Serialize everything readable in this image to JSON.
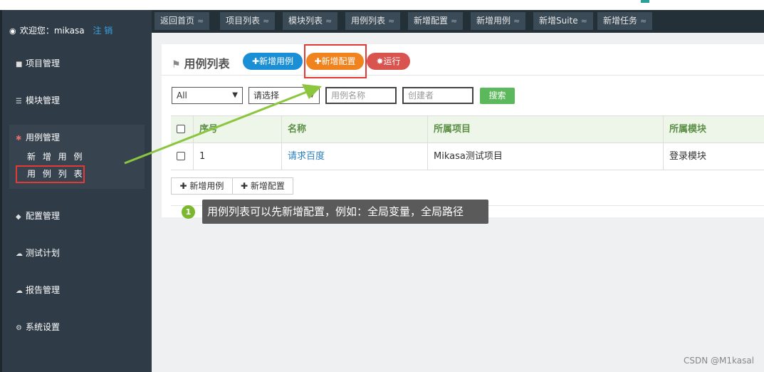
{
  "sidebar": {
    "welcome_text": "欢迎您：mikasa",
    "logout_label": "注 销",
    "items": [
      {
        "icon": "folder-icon",
        "label": "项目管理"
      },
      {
        "icon": "list-icon",
        "label": "模块管理"
      },
      {
        "icon": "bug-icon",
        "label": "用例管理"
      },
      {
        "icon": "tag-icon",
        "label": "配置管理"
      },
      {
        "icon": "cloud-icon",
        "label": "测试计划"
      },
      {
        "icon": "cloud-upload-icon",
        "label": "报告管理"
      },
      {
        "icon": "cogs-icon",
        "label": "系统设置"
      }
    ],
    "sub_items": [
      {
        "label": "新 增 用 例"
      },
      {
        "label": "用 例 列 表"
      }
    ]
  },
  "tabs": [
    {
      "label": "返回首页"
    },
    {
      "label": "项目列表"
    },
    {
      "label": "模块列表"
    },
    {
      "label": "用例列表"
    },
    {
      "label": "新增配置"
    },
    {
      "label": "新增用例"
    },
    {
      "label": "新增Suite"
    },
    {
      "label": "新增任务"
    }
  ],
  "panel": {
    "title": "用例列表",
    "add_case_label": "✚新增用例",
    "add_config_label": "✚新增配置",
    "run_label": "运行",
    "colors": {
      "add_case": "#1a8fd6",
      "add_config": "#f0831d",
      "run": "#d9534f",
      "search": "#5cb85c"
    }
  },
  "filters": {
    "scope_value": "All",
    "select_value": "请选择",
    "case_name_placeholder": "用例名称",
    "creator_placeholder": "创建者",
    "search_label": "搜索"
  },
  "table": {
    "headers": [
      "序号",
      "名称",
      "所属项目",
      "所属模块"
    ],
    "rows": [
      {
        "index": "1",
        "name": "请求百度",
        "project": "Mikasa测试项目",
        "module": "登录模块"
      }
    ]
  },
  "bottom_buttons": {
    "add_case_label": "新增用例",
    "add_config_label": "新增配置"
  },
  "callout": {
    "number": "1",
    "text": "用例列表可以先新增配置，例如：全局变量，全局路径"
  },
  "watermark": "CSDN @M1kasal"
}
